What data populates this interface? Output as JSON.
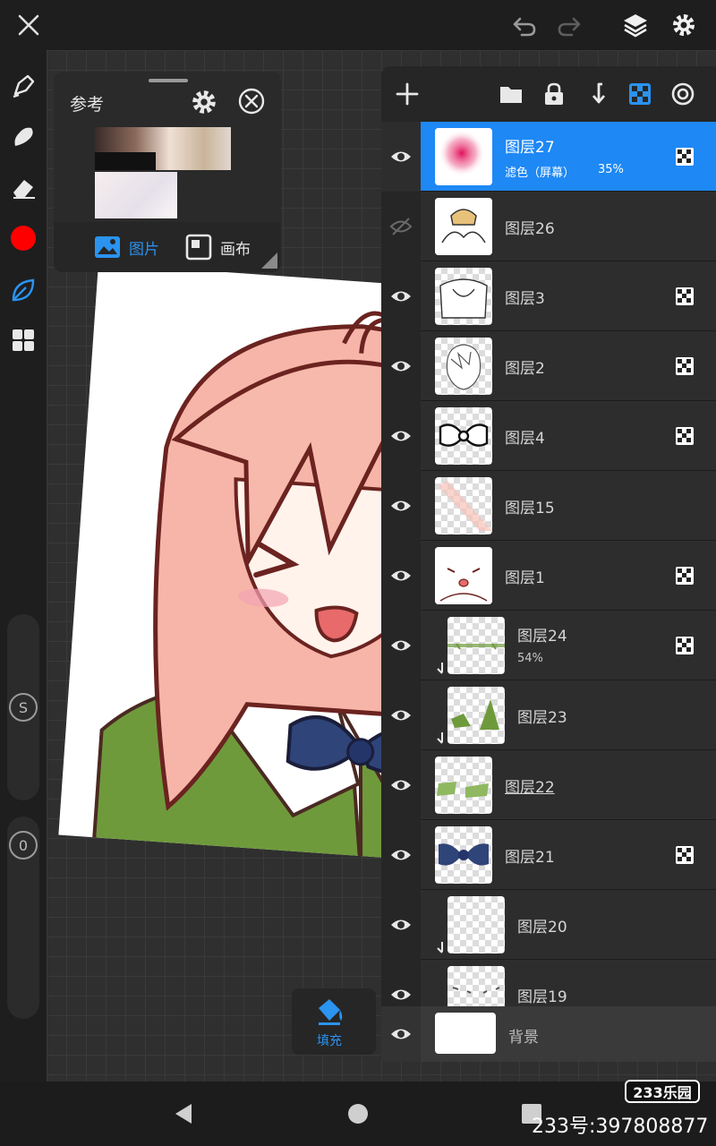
{
  "reference_panel": {
    "title": "参考",
    "tabs": [
      {
        "label": "图片",
        "active": true
      },
      {
        "label": "画布",
        "active": false
      }
    ]
  },
  "layers": [
    {
      "name": "图层27",
      "blend": "滤色（屏幕）",
      "opacity": "35%",
      "visible": true,
      "selected": true,
      "alpha_lock": true
    },
    {
      "name": "图层26",
      "visible": false,
      "alpha_lock": false
    },
    {
      "name": "图层3",
      "visible": true,
      "alpha_lock": true
    },
    {
      "name": "图层2",
      "visible": true,
      "alpha_lock": true
    },
    {
      "name": "图层4",
      "visible": true,
      "alpha_lock": true
    },
    {
      "name": "图层15",
      "visible": true,
      "alpha_lock": false
    },
    {
      "name": "图层1",
      "visible": true,
      "alpha_lock": true
    },
    {
      "name": "图层24",
      "opacity": "54%",
      "visible": true,
      "clipped": true,
      "alpha_lock": true
    },
    {
      "name": "图层23",
      "visible": true,
      "clipped": true,
      "alpha_lock": false
    },
    {
      "name": "图层22",
      "visible": true,
      "alpha_lock": false
    },
    {
      "name": "图层21",
      "visible": true,
      "alpha_lock": true
    },
    {
      "name": "图层20",
      "visible": true,
      "clipped": true,
      "alpha_lock": false
    },
    {
      "name": "图层19",
      "visible": true,
      "clipped": false,
      "alpha_lock": false
    }
  ],
  "background_layer": {
    "name": "背景"
  },
  "fill_tool": {
    "label": "填充"
  },
  "watermark": {
    "logo": "233乐园",
    "id_text": "233号:397808877"
  },
  "colors": {
    "accent": "#1e88f5",
    "current_color": "#ff0000",
    "panel": "#2a2a2a",
    "selected_row": "#1e88f5"
  },
  "icons": {
    "top": [
      "close-icon",
      "undo-icon",
      "redo-icon",
      "layers-icon",
      "settings-gear-icon"
    ],
    "left": [
      "brush-icon",
      "smudge-icon",
      "eraser-icon",
      "color-swatch",
      "leaf-brush-icon",
      "grid-menu-icon"
    ],
    "layers_toolbar": [
      "add-layer-icon",
      "folder-icon",
      "lock-icon",
      "merge-down-icon",
      "alpha-lock-icon",
      "blend-target-icon"
    ]
  },
  "sliders": {
    "size_label": "S",
    "opacity_label": "0"
  }
}
